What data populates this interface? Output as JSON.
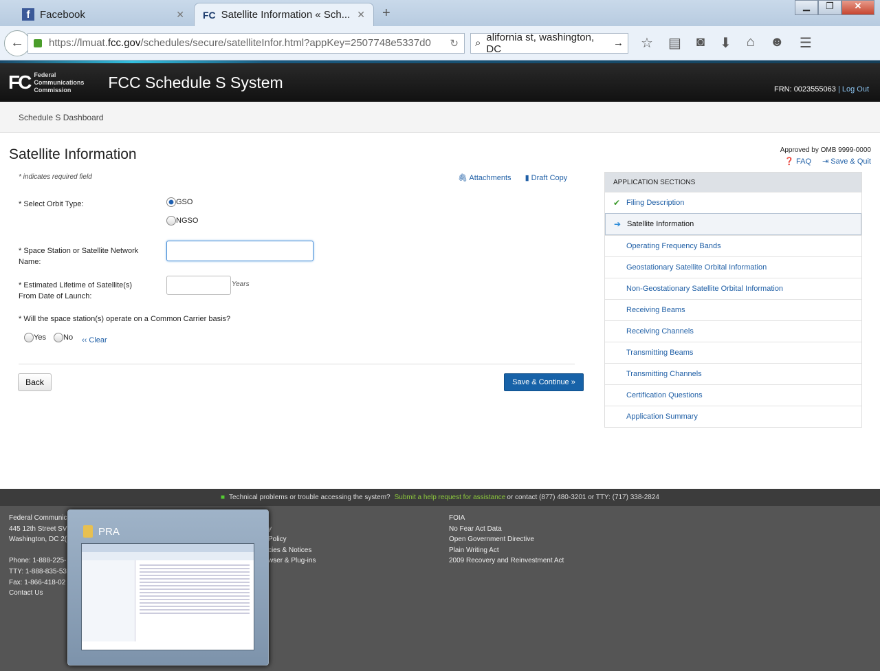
{
  "browser": {
    "tabs": [
      {
        "label": "Facebook",
        "active": false
      },
      {
        "label": "Satellite Information « Sch...",
        "active": true
      }
    ],
    "url_prefix": "https://lmuat.",
    "url_domain": "fcc.gov",
    "url_suffix": "/schedules/secure/satelliteInfor.html?appKey=2507748e5337d0",
    "search_value": "alifornia st, washington, DC"
  },
  "header": {
    "agency": "Federal Communications Commission",
    "logo": "FC",
    "title": "FCC Schedule S System",
    "frn": "FRN: 0023555063",
    "sep": "|",
    "logout": "Log Out"
  },
  "subnav": {
    "dashboard": "Schedule S Dashboard"
  },
  "page": {
    "title": "Satellite Information",
    "approved": "Approved by OMB 9999-0000",
    "faq": "FAQ",
    "save_quit": "Save & Quit",
    "required_note": "* indicates required field",
    "attachments": "Attachments",
    "draft_copy": "Draft Copy",
    "orbit_label": "* Select Orbit Type:",
    "orbit_options": [
      "GSO",
      "NGSO"
    ],
    "orbit_selected": "GSO",
    "name_label": "* Space Station or Satellite Network Name:",
    "name_value": "",
    "lifetime_label": "* Estimated Lifetime of Satellite(s) From Date of Launch:",
    "lifetime_value": "",
    "lifetime_unit": "Years",
    "carrier_label": "* Will the space station(s) operate on a Common Carrier basis?",
    "carrier_options": [
      "Yes",
      "No"
    ],
    "clear": "‹‹ Clear",
    "back": "Back",
    "save_continue": "Save & Continue »"
  },
  "sections": {
    "header": "APPLICATION SECTIONS",
    "items": [
      {
        "label": "Filing Description",
        "status": "complete"
      },
      {
        "label": "Satellite Information",
        "status": "current"
      },
      {
        "label": "Operating Frequency Bands"
      },
      {
        "label": "Geostationary Satellite Orbital Information"
      },
      {
        "label": "Non-Geostationary Satellite Orbital Information"
      },
      {
        "label": "Receiving Beams"
      },
      {
        "label": "Receiving Channels"
      },
      {
        "label": "Transmitting Beams"
      },
      {
        "label": "Transmitting Channels"
      },
      {
        "label": "Certification Questions"
      },
      {
        "label": "Application Summary"
      }
    ]
  },
  "footer": {
    "help_text": "Technical problems or trouble accessing the system?",
    "help_link": "Submit a help request for assistance",
    "help_contact": "or contact (877) 480-3201 or TTY: (717) 338-2824",
    "address": [
      "Federal Communic",
      "445 12th Street SV",
      "Washington, DC 2(",
      "",
      "Phone: 1-888-225-",
      "TTY: 1-888-835-53",
      "Fax: 1-866-418-02",
      "Contact Us"
    ],
    "col2": [
      "",
      "y",
      "Policy",
      "cies & Notices",
      "wser & Plug-ins"
    ],
    "col3": [
      "FOIA",
      "No Fear Act Data",
      "Open Government Directive",
      "Plain Writing Act",
      "2009 Recovery and Reinvestment Act"
    ]
  },
  "taskbar_preview": {
    "title": "PRA"
  }
}
